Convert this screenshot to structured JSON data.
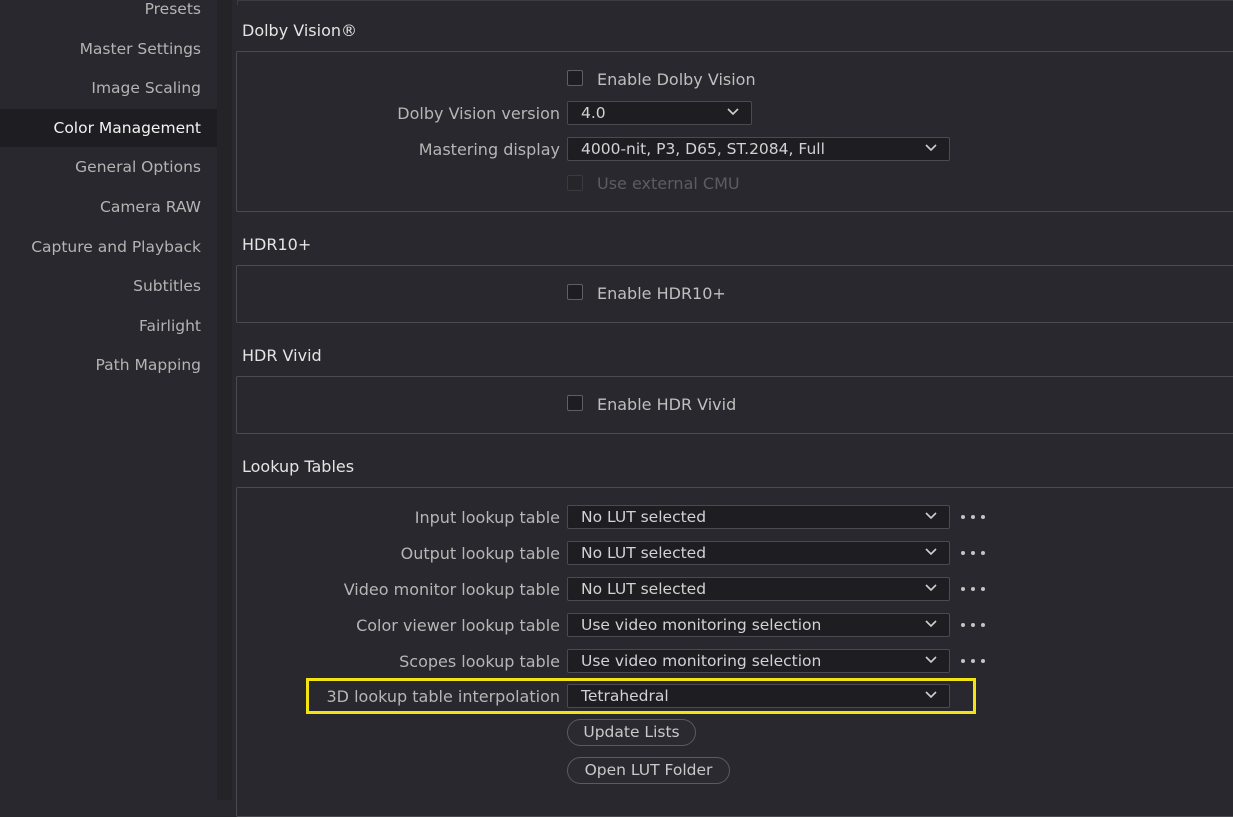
{
  "sidebar": {
    "items": [
      {
        "label": "Presets",
        "active": false
      },
      {
        "label": "Master Settings",
        "active": false
      },
      {
        "label": "Image Scaling",
        "active": false
      },
      {
        "label": "Color Management",
        "active": true
      },
      {
        "label": "General Options",
        "active": false
      },
      {
        "label": "Camera RAW",
        "active": false
      },
      {
        "label": "Capture and Playback",
        "active": false
      },
      {
        "label": "Subtitles",
        "active": false
      },
      {
        "label": "Fairlight",
        "active": false
      },
      {
        "label": "Path Mapping",
        "active": false
      }
    ]
  },
  "dolby": {
    "title": "Dolby Vision®",
    "enable_label": "Enable Dolby Vision",
    "enable_checked": false,
    "version_label": "Dolby Vision version",
    "version_value": "4.0",
    "mastering_label": "Mastering display",
    "mastering_value": "4000-nit, P3, D65, ST.2084, Full",
    "external_cmu_label": "Use external CMU",
    "external_cmu_disabled": true
  },
  "hdr10": {
    "title": "HDR10+",
    "enable_label": "Enable HDR10+",
    "enable_checked": false
  },
  "hdrvivid": {
    "title": "HDR Vivid",
    "enable_label": "Enable HDR Vivid",
    "enable_checked": false
  },
  "lut": {
    "title": "Lookup Tables",
    "rows": [
      {
        "label": "Input lookup table",
        "value": "No LUT selected"
      },
      {
        "label": "Output lookup table",
        "value": "No LUT selected"
      },
      {
        "label": "Video monitor lookup table",
        "value": "No LUT selected"
      },
      {
        "label": "Color viewer lookup table",
        "value": "Use video monitoring selection"
      },
      {
        "label": "Scopes lookup table",
        "value": "Use video monitoring selection"
      }
    ],
    "interp_label": "3D lookup table interpolation",
    "interp_value": "Tetrahedral",
    "update_button": "Update Lists",
    "open_folder_button": "Open LUT Folder"
  },
  "colors": {
    "background": "#28282e",
    "highlight": "#f2e313",
    "active_sidebar": "#1e1e22"
  }
}
